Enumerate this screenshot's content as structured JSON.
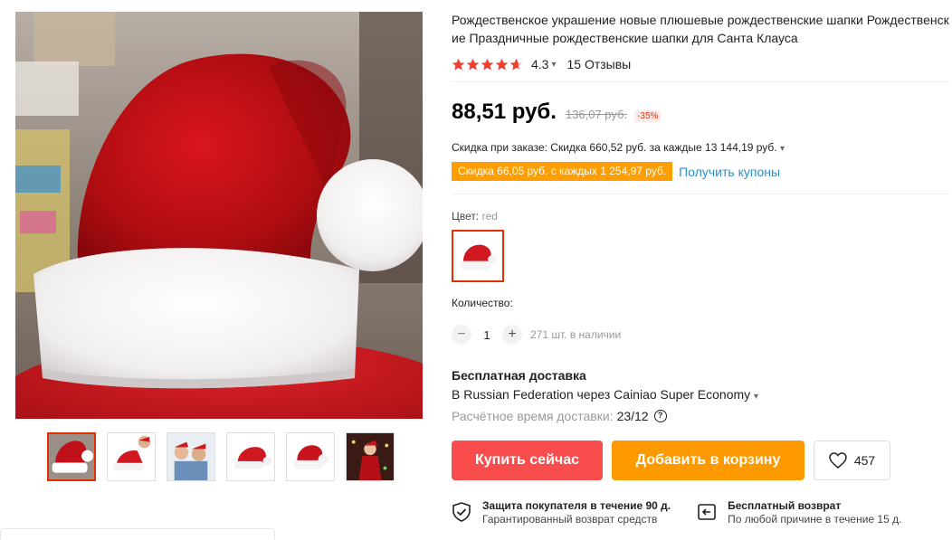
{
  "product": {
    "title": "Рождественское украшение новые плюшевые рождественские шапки Рождественские Праздничные рождественские шапки для Санта Клауса",
    "rating": "4.3",
    "reviews": "15 Отзывы",
    "price": "88,51 руб.",
    "old_price": "136,07 руб.",
    "discount": "-35%",
    "order_discount": "Скидка при заказе: Скидка 660,52 руб. за каждые 13 144,19 руб.",
    "coupon_badge": "Скидка 66,05 руб. с каждых 1 254,97 руб.",
    "coupon_link": "Получить купоны",
    "color_label": "Цвет:",
    "color_value": "red",
    "quantity_label": "Количество:",
    "quantity_minus": "−",
    "quantity_plus": "+",
    "quantity": "1",
    "stock": "271 шт. в наличии"
  },
  "shipping": {
    "title": "Бесплатная доставка",
    "method": "В Russian Federation через Cainiao Super Economy",
    "eta_label": "Расчётное время доставки:",
    "eta_date": "23/12",
    "help_icon": "?"
  },
  "actions": {
    "buy_now": "Купить сейчас",
    "add_to_cart": "Добавить в корзину",
    "wishlist_count": "457"
  },
  "guarantees": [
    {
      "title": "Защита покупателя в течение 90 д.",
      "subtitle": "Гарантированный возврат средств",
      "icon": "shield-check-icon"
    },
    {
      "title": "Бесплатный возврат",
      "subtitle": "По любой причине в течение 15 д.",
      "icon": "return-icon"
    }
  ],
  "colors": {
    "accent": "#e62e04",
    "buy_button": "#f94c4c",
    "cart_button": "#ff9900",
    "coupon": "#ff9e00",
    "link": "#2e8fc9",
    "star": "#f53d2d"
  },
  "icons": {
    "star": "star-icon",
    "chevron": "chevron-down-icon",
    "heart": "heart-icon"
  }
}
